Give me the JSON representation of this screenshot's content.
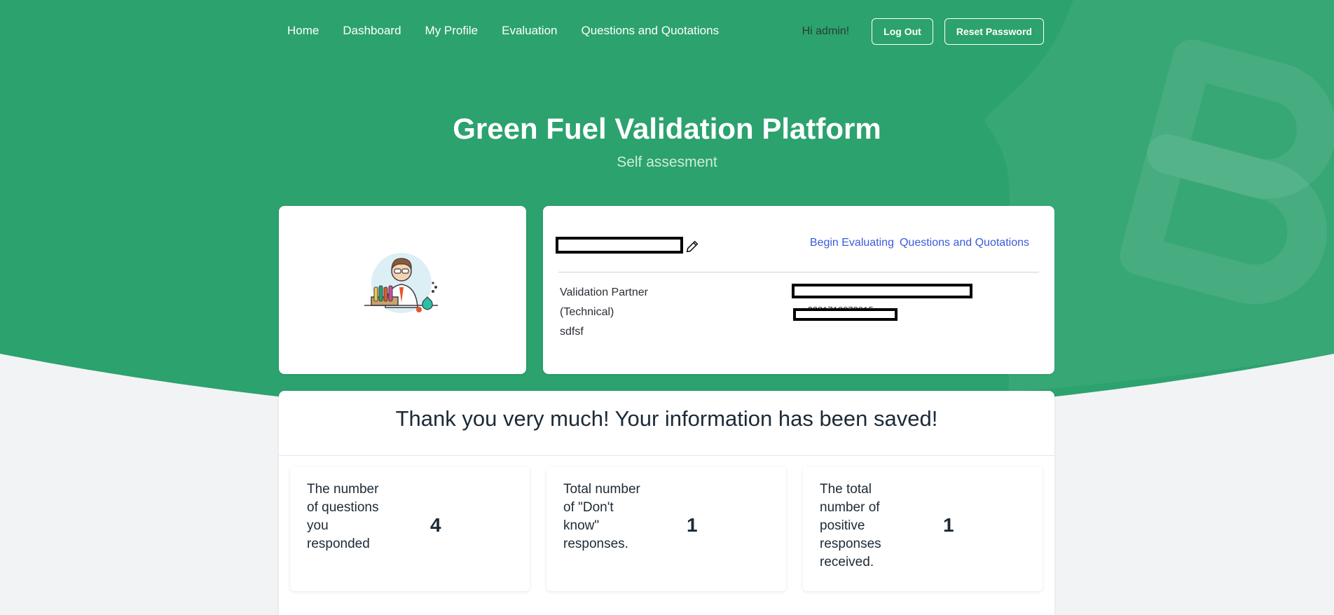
{
  "colors": {
    "brand_green": "#2ca26e",
    "link_blue": "#3b5bd8",
    "background": "#f2f3f5"
  },
  "nav": {
    "links": [
      "Home",
      "Dashboard",
      "My Profile",
      "Evaluation",
      "Questions and Quotations"
    ],
    "greeting": "Hi admin!",
    "logout_label": "Log Out",
    "reset_label": "Reset Password"
  },
  "hero": {
    "title": "Green Fuel Validation Platform",
    "subtitle": "Self assesment"
  },
  "profile": {
    "avatar_icon": "scientist-illustration",
    "edit_icon": "pencil-icon",
    "links": [
      "Begin Evaluating",
      "Questions and Quotations"
    ],
    "role_lines": [
      "Validation Partner",
      "(Technical)",
      "sdfsf"
    ],
    "phone_partial": "+3281718872815"
  },
  "result": {
    "title": "Thank you very much! Your information has been saved!",
    "stats": [
      {
        "label": "The number of questions you responded",
        "value": "4"
      },
      {
        "label": "Total number of \"Don't know\" responses.",
        "value": "1"
      },
      {
        "label": "The total number of positive responses received.",
        "value": "1"
      }
    ]
  }
}
